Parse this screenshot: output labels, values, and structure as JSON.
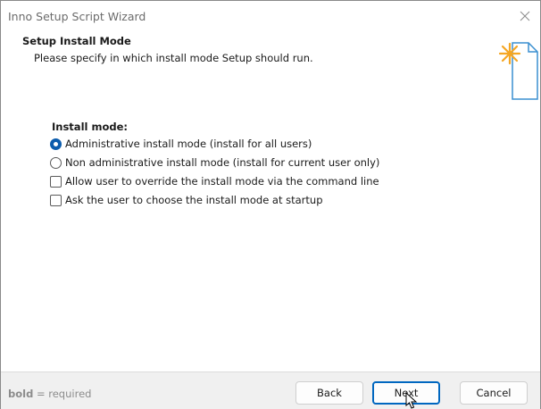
{
  "window": {
    "title": "Inno Setup Script Wizard"
  },
  "header": {
    "title": "Setup Install Mode",
    "description": "Please specify in which install mode Setup should run.",
    "icon": "document-star-icon"
  },
  "install_mode": {
    "label": "Install mode:",
    "options": [
      {
        "label": "Administrative install mode (install for all users)",
        "type": "radio",
        "checked": true
      },
      {
        "label": "Non administrative install mode (install for current user only)",
        "type": "radio",
        "checked": false
      },
      {
        "label": "Allow user to override the install mode via the command line",
        "type": "checkbox",
        "checked": false
      },
      {
        "label": "Ask the user to choose the install mode at startup",
        "type": "checkbox",
        "checked": false
      }
    ]
  },
  "footer": {
    "note_bold": "bold",
    "note_rest": " = required",
    "back_label": "Back",
    "next_label": "Next",
    "cancel_label": "Cancel"
  },
  "colors": {
    "accent": "#0067c0",
    "star": "#f5a623",
    "title_text": "#6b6b6b",
    "footer_bg": "#f0f0f0"
  }
}
